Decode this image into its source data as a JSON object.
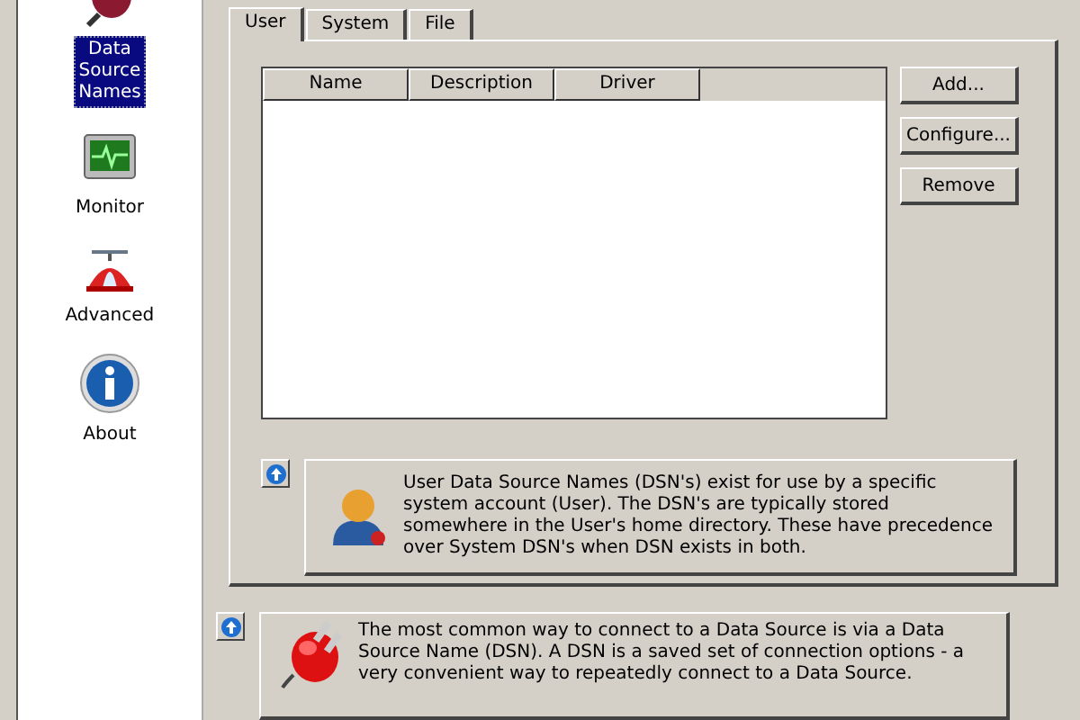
{
  "sidebar": {
    "items": [
      {
        "kind": "dsn",
        "label": "Data Source Names",
        "selected": true
      },
      {
        "kind": "monitor",
        "label": "Monitor",
        "selected": false
      },
      {
        "kind": "advanced",
        "label": "Advanced",
        "selected": false
      },
      {
        "kind": "about",
        "label": "About",
        "selected": false
      }
    ]
  },
  "tabs": [
    {
      "label": "User",
      "selected": true
    },
    {
      "label": "System",
      "selected": false
    },
    {
      "label": "File",
      "selected": false
    }
  ],
  "table": {
    "columns": [
      "Name",
      "Description",
      "Driver"
    ]
  },
  "buttons": [
    "Add...",
    "Configure...",
    "Remove"
  ],
  "info_panel": {
    "text": "User Data Source Names (DSN's) exist for use by a specific system account (User). The DSN's are typically stored somewhere in the User's home directory. These have precedence over System DSN's when DSN exists in both."
  },
  "footer_panel": {
    "text": "The most common way to connect to a Data Source is via a Data Source Name (DSN). A DSN is a saved set of connection options - a very convenient way to repeatedly connect to a Data Source."
  }
}
